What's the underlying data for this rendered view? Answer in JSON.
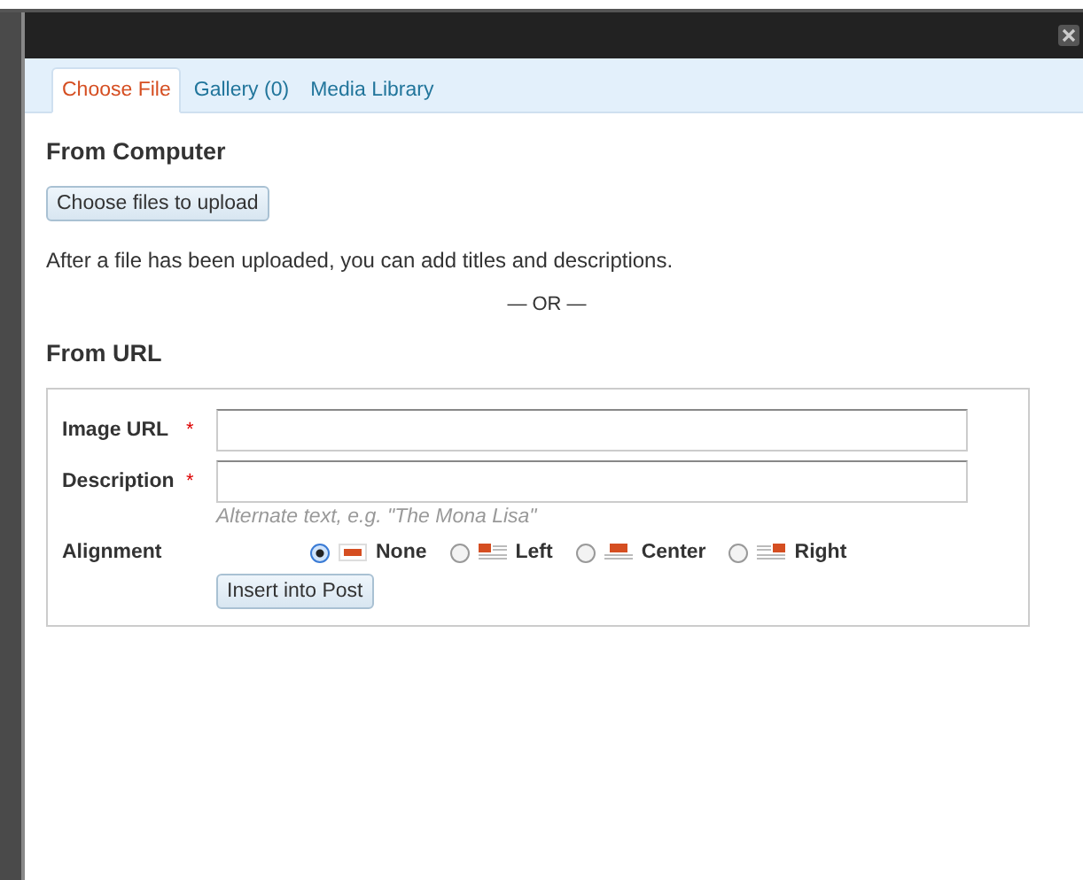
{
  "tabs": [
    {
      "label": "Choose File",
      "selected": true
    },
    {
      "label": "Gallery (0)",
      "selected": false
    },
    {
      "label": "Media Library",
      "selected": false
    }
  ],
  "from_computer": {
    "heading": "From Computer",
    "button": "Choose files to upload",
    "note": "After a file has been uploaded, you can add titles and descriptions.",
    "separator": "— OR —"
  },
  "from_url": {
    "heading": "From URL",
    "fields": [
      {
        "label": "Image URL",
        "required_mark": "*"
      },
      {
        "label": "Description",
        "required_mark": "*",
        "hint": "Alternate text, e.g. \"The Mona Lisa\""
      }
    ],
    "alignment": {
      "label": "Alignment",
      "options": [
        {
          "kind": "none",
          "label": "None",
          "selected": true
        },
        {
          "kind": "left",
          "label": "Left",
          "selected": false
        },
        {
          "kind": "center",
          "label": "Center",
          "selected": false
        },
        {
          "kind": "right",
          "label": "Right",
          "selected": false
        }
      ]
    },
    "button": "Insert into Post"
  }
}
